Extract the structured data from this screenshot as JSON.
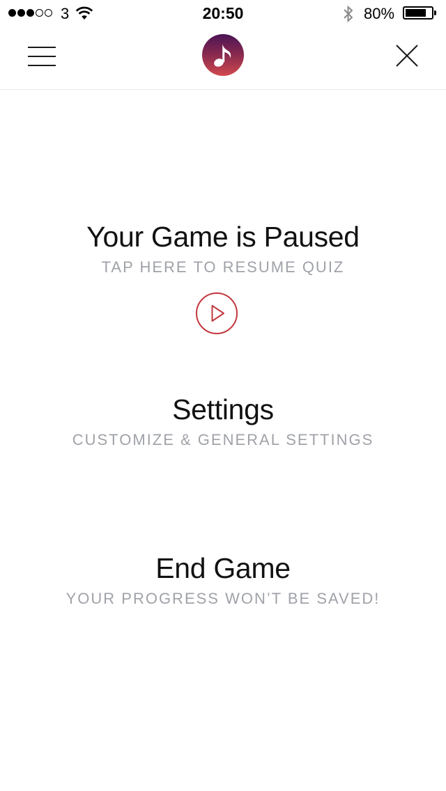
{
  "status_bar": {
    "carrier": "3",
    "time": "20:50",
    "battery_percent": "80%",
    "battery_level": 0.8,
    "signal_strength": 3,
    "signal_max": 5
  },
  "nav": {
    "menu_icon": "hamburger-menu-icon",
    "logo_icon": "music-note-icon",
    "close_icon": "close-icon",
    "logo_gradient": [
      "#4a1456",
      "#d2494f"
    ]
  },
  "menu": {
    "pause": {
      "title": "Your Game is Paused",
      "subtitle": "TAP HERE TO RESUME QUIZ",
      "action_icon": "play-icon",
      "accent": "#c2373f"
    },
    "settings": {
      "title": "Settings",
      "subtitle": "CUSTOMIZE & GENERAL SETTINGS"
    },
    "end_game": {
      "title": "End Game",
      "subtitle": "YOUR PROGRESS WON’T BE SAVED!"
    }
  }
}
